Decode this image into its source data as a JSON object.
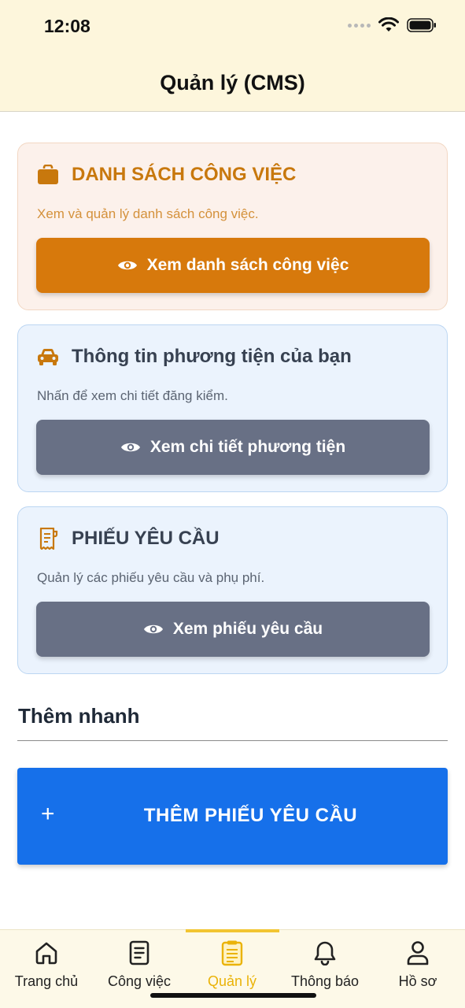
{
  "status": {
    "time": "12:08"
  },
  "header": {
    "title": "Quản lý (CMS)"
  },
  "cards": [
    {
      "title": "DANH SÁCH CÔNG VIỆC",
      "description": "Xem và quản lý danh sách công việc.",
      "button": "Xem danh sách công việc",
      "icon": "briefcase-icon"
    },
    {
      "title": "Thông tin phương tiện của bạn",
      "description": "Nhấn để xem chi tiết đăng kiểm.",
      "button": "Xem chi tiết phương tiện",
      "icon": "car-icon"
    },
    {
      "title": "PHIẾU YÊU CẦU",
      "description": "Quản lý các phiếu yêu cầu và phụ phí.",
      "button": "Xem phiếu yêu cầu",
      "icon": "receipt-icon"
    }
  ],
  "quick_add": {
    "section_title": "Thêm nhanh",
    "button": "THÊM PHIẾU YÊU CẦU",
    "icon": "plus-icon"
  },
  "tabs": [
    {
      "label": "Trang chủ",
      "icon": "home-icon",
      "active": false
    },
    {
      "label": "Công việc",
      "icon": "document-icon",
      "active": false
    },
    {
      "label": "Quản lý",
      "icon": "clipboard-icon",
      "active": true
    },
    {
      "label": "Thông báo",
      "icon": "bell-icon",
      "active": false
    },
    {
      "label": "Hồ sơ",
      "icon": "user-icon",
      "active": false
    }
  ],
  "colors": {
    "accent_orange": "#d7790c",
    "slate_button": "#687085",
    "primary_blue": "#1670ea",
    "active_tab": "#eab308",
    "header_bg": "#fdf6dc"
  }
}
